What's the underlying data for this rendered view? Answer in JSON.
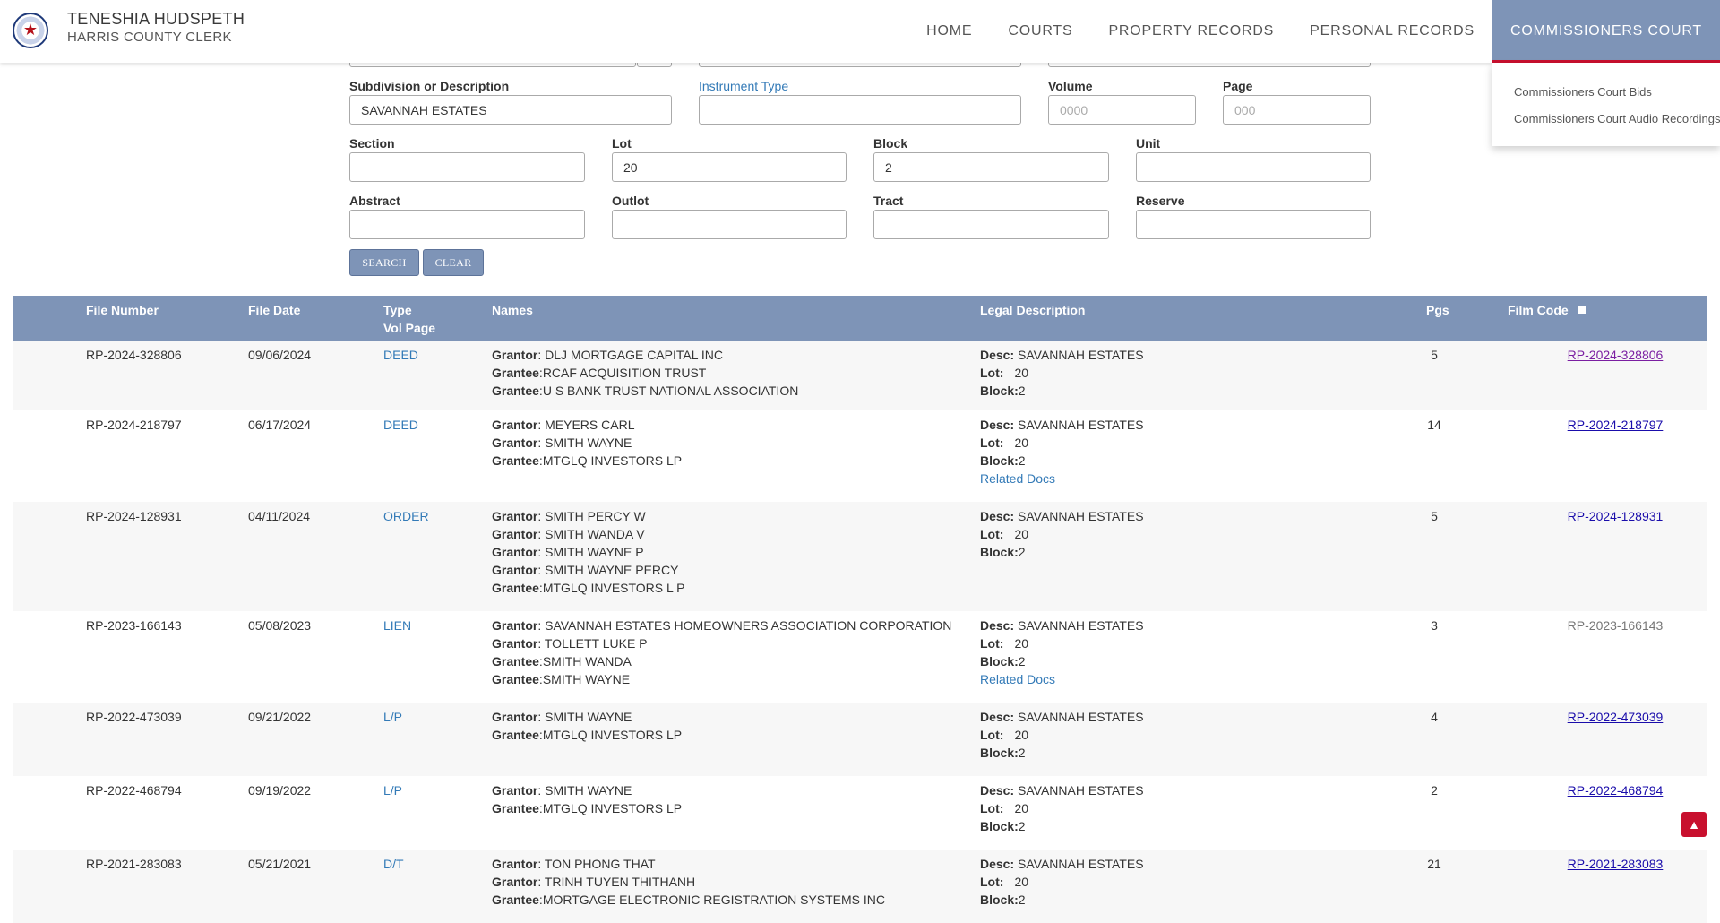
{
  "header": {
    "brand_name": "TENESHIA HUDSPETH",
    "brand_sub": "HARRIS COUNTY CLERK",
    "nav": [
      "HOME",
      "COURTS",
      "PROPERTY RECORDS",
      "PERSONAL RECORDS",
      "COMMISSIONERS COURT"
    ],
    "active_nav": "COMMISSIONERS COURT",
    "dropdown": [
      "Commissioners Court Bids",
      "Commissioners Court Audio Recordings"
    ]
  },
  "form": {
    "subdivision_label": "Subdivision or Description",
    "subdivision_value": "SAVANNAH ESTATES",
    "instrument_label": "Instrument Type",
    "instrument_value": "",
    "volume_label": "Volume",
    "volume_placeholder": "0000",
    "page_label": "Page",
    "page_placeholder": "000",
    "section_label": "Section",
    "section_value": "",
    "lot_label": "Lot",
    "lot_value": "20",
    "block_label": "Block",
    "block_value": "2",
    "unit_label": "Unit",
    "unit_value": "",
    "abstract_label": "Abstract",
    "abstract_value": "",
    "outlot_label": "Outlot",
    "outlot_value": "",
    "tract_label": "Tract",
    "tract_value": "",
    "reserve_label": "Reserve",
    "reserve_value": "",
    "search_label": "SEARCH",
    "clear_label": "CLEAR"
  },
  "table": {
    "headers": {
      "file_number": "File Number",
      "file_date": "File Date",
      "type": "Type",
      "vol_page": "Vol Page",
      "names": "Names",
      "legal_description": "Legal Description",
      "pgs": "Pgs",
      "film_code": "Film Code"
    },
    "labels": {
      "desc": "Desc:",
      "lot": "Lot:",
      "block": "Block:",
      "related_docs": "Related Docs"
    },
    "rows": [
      {
        "file_number": "RP-2024-328806",
        "file_date": "09/06/2024",
        "type": "DEED",
        "names": [
          {
            "role": "Grantor",
            "sep": ": ",
            "name": "DLJ MORTGAGE CAPITAL INC"
          },
          {
            "role": "Grantee",
            "sep": ":",
            "name": "RCAF ACQUISITION TRUST"
          },
          {
            "role": "Grantee",
            "sep": ":",
            "name": "U S BANK TRUST NATIONAL ASSOCIATION"
          }
        ],
        "desc": "SAVANNAH ESTATES",
        "lot": "20",
        "block": "2",
        "related": false,
        "pgs": "5",
        "film_code": "RP-2024-328806",
        "film_style": "visited"
      },
      {
        "file_number": "RP-2024-218797",
        "file_date": "06/17/2024",
        "type": "DEED",
        "names": [
          {
            "role": "Grantor",
            "sep": ": ",
            "name": "MEYERS CARL"
          },
          {
            "role": "Grantor",
            "sep": ": ",
            "name": "SMITH WAYNE"
          },
          {
            "role": "Grantee",
            "sep": ":",
            "name": "MTGLQ INVESTORS LP"
          }
        ],
        "desc": "SAVANNAH ESTATES",
        "lot": "20",
        "block": "2",
        "related": true,
        "pgs": "14",
        "film_code": "RP-2024-218797",
        "film_style": "link"
      },
      {
        "file_number": "RP-2024-128931",
        "file_date": "04/11/2024",
        "type": "ORDER",
        "names": [
          {
            "role": "Grantor",
            "sep": ": ",
            "name": "SMITH PERCY W"
          },
          {
            "role": "Grantor",
            "sep": ": ",
            "name": "SMITH WANDA V"
          },
          {
            "role": "Grantor",
            "sep": ": ",
            "name": "SMITH WAYNE P"
          },
          {
            "role": "Grantor",
            "sep": ": ",
            "name": "SMITH WAYNE PERCY"
          },
          {
            "role": "Grantee",
            "sep": ":",
            "name": "MTGLQ INVESTORS L P"
          }
        ],
        "desc": "SAVANNAH ESTATES",
        "lot": "20",
        "block": "2",
        "related": false,
        "pgs": "5",
        "film_code": "RP-2024-128931",
        "film_style": "link"
      },
      {
        "file_number": "RP-2023-166143",
        "file_date": "05/08/2023",
        "type": "LIEN",
        "names": [
          {
            "role": "Grantor",
            "sep": ": ",
            "name": "SAVANNAH ESTATES HOMEOWNERS ASSOCIATION CORPORATION"
          },
          {
            "role": "Grantor",
            "sep": ": ",
            "name": "TOLLETT LUKE P"
          },
          {
            "role": "Grantee",
            "sep": ":",
            "name": "SMITH WANDA"
          },
          {
            "role": "Grantee",
            "sep": ":",
            "name": "SMITH WAYNE"
          }
        ],
        "desc": "SAVANNAH ESTATES",
        "lot": "20",
        "block": "2",
        "related": true,
        "pgs": "3",
        "film_code": "RP-2023-166143",
        "film_style": "plain"
      },
      {
        "file_number": "RP-2022-473039",
        "file_date": "09/21/2022",
        "type": "L/P",
        "names": [
          {
            "role": "Grantor",
            "sep": ": ",
            "name": "SMITH WAYNE"
          },
          {
            "role": "Grantee",
            "sep": ":",
            "name": "MTGLQ INVESTORS LP"
          }
        ],
        "desc": "SAVANNAH ESTATES",
        "lot": "20",
        "block": "2",
        "related": false,
        "pgs": "4",
        "film_code": "RP-2022-473039",
        "film_style": "link"
      },
      {
        "file_number": "RP-2022-468794",
        "file_date": "09/19/2022",
        "type": "L/P",
        "names": [
          {
            "role": "Grantor",
            "sep": ": ",
            "name": "SMITH WAYNE"
          },
          {
            "role": "Grantee",
            "sep": ":",
            "name": "MTGLQ INVESTORS LP"
          }
        ],
        "desc": "SAVANNAH ESTATES",
        "lot": "20",
        "block": "2",
        "related": false,
        "pgs": "2",
        "film_code": "RP-2022-468794",
        "film_style": "link"
      },
      {
        "file_number": "RP-2021-283083",
        "file_date": "05/21/2021",
        "type": "D/T",
        "names": [
          {
            "role": "Grantor",
            "sep": ": ",
            "name": "TON PHONG THAT"
          },
          {
            "role": "Grantor",
            "sep": ": ",
            "name": "TRINH TUYEN THITHANH"
          },
          {
            "role": "Grantee",
            "sep": ":",
            "name": "MORTGAGE ELECTRONIC REGISTRATION SYSTEMS INC"
          }
        ],
        "desc": "SAVANNAH ESTATES",
        "lot": "20",
        "block": "2",
        "related": false,
        "pgs": "21",
        "film_code": "RP-2021-283083",
        "film_style": "link"
      }
    ]
  },
  "icons": {
    "scroll_top": "chevron-up-icon",
    "seal": "county-seal-icon",
    "film_checkbox": "checkbox-icon"
  }
}
